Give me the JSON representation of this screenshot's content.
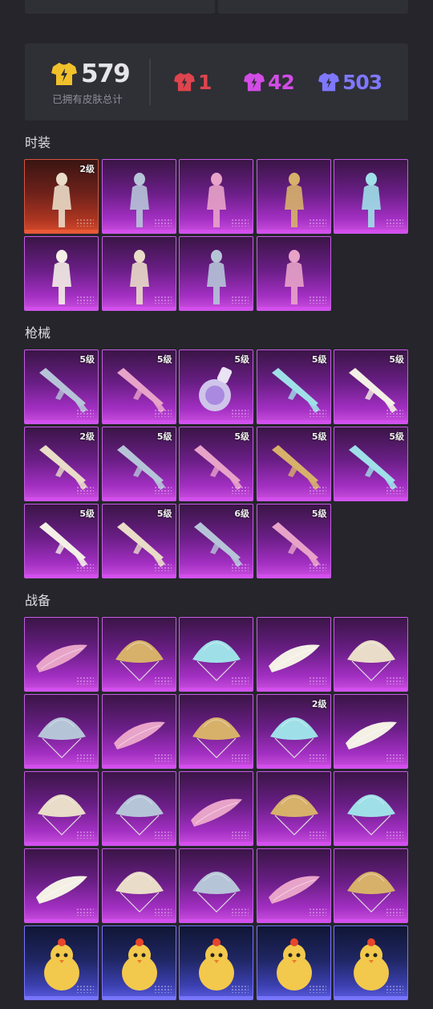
{
  "summary": {
    "total_count": "579",
    "total_label": "已拥有皮肤总计",
    "tiers": [
      {
        "value": "1",
        "color": "#e0444e",
        "icon": "red-shirt-icon"
      },
      {
        "value": "42",
        "color": "#d24ce6",
        "icon": "purple-shirt-icon"
      },
      {
        "value": "503",
        "color": "#7f78ff",
        "icon": "blue-shirt-icon"
      }
    ],
    "total_icon": "gold-shirt-icon",
    "total_color": "#f1c12b"
  },
  "sections": [
    {
      "title": "时装",
      "items": [
        {
          "name": "gold-winged-outfit",
          "rarity": "gold",
          "level": "2级"
        },
        {
          "name": "red-black-armor-outfit",
          "rarity": "purple",
          "level": ""
        },
        {
          "name": "white-gold-robe-outfit",
          "rarity": "purple",
          "level": ""
        },
        {
          "name": "red-hair-girl-outfit",
          "rarity": "purple",
          "level": ""
        },
        {
          "name": "silver-armor-outfit",
          "rarity": "purple",
          "level": ""
        },
        {
          "name": "white-gown-outfit",
          "rarity": "purple",
          "level": ""
        },
        {
          "name": "white-dress-outfit",
          "rarity": "purple",
          "level": ""
        },
        {
          "name": "blue-pink-suit-outfit",
          "rarity": "purple",
          "level": ""
        },
        {
          "name": "purple-helmet-outfit",
          "rarity": "purple",
          "level": ""
        }
      ]
    },
    {
      "title": "枪械",
      "items": [
        {
          "name": "orange-rifle",
          "rarity": "purple",
          "level": "5级"
        },
        {
          "name": "black-sniper-rifle",
          "rarity": "purple",
          "level": "5级"
        },
        {
          "name": "potion-bottle-weapon",
          "rarity": "purple",
          "level": "5级"
        },
        {
          "name": "silver-sniper-rifle",
          "rarity": "purple",
          "level": "5级"
        },
        {
          "name": "red-dragon-rifle",
          "rarity": "purple",
          "level": "5级"
        },
        {
          "name": "golden-rifle",
          "rarity": "purple",
          "level": "2级"
        },
        {
          "name": "steel-rifle",
          "rarity": "purple",
          "level": "5级"
        },
        {
          "name": "blue-silver-rifle",
          "rarity": "purple",
          "level": "5级"
        },
        {
          "name": "ornate-silver-smg",
          "rarity": "purple",
          "level": "5级"
        },
        {
          "name": "pink-black-smg",
          "rarity": "purple",
          "level": "5级"
        },
        {
          "name": "green-rifle",
          "rarity": "purple",
          "level": "5级"
        },
        {
          "name": "blue-smg",
          "rarity": "purple",
          "level": "5级"
        },
        {
          "name": "teal-gold-rifle",
          "rarity": "purple",
          "level": "6级"
        },
        {
          "name": "green-blue-rifle",
          "rarity": "purple",
          "level": "5级"
        }
      ]
    },
    {
      "title": "战备",
      "items": [
        {
          "name": "pink-glider",
          "rarity": "purple",
          "level": ""
        },
        {
          "name": "blue-floral-glider",
          "rarity": "purple",
          "level": ""
        },
        {
          "name": "blue-gold-parachute",
          "rarity": "purple",
          "level": ""
        },
        {
          "name": "lace-cat-parachute",
          "rarity": "purple",
          "level": ""
        },
        {
          "name": "cream-pattern-parachute",
          "rarity": "purple",
          "level": ""
        },
        {
          "name": "white-ornate-parachute",
          "rarity": "purple",
          "level": ""
        },
        {
          "name": "white-dragon-pet",
          "rarity": "purple",
          "level": ""
        },
        {
          "name": "golden-wing-glider",
          "rarity": "purple",
          "level": ""
        },
        {
          "name": "golden-dragon-pet",
          "rarity": "purple",
          "level": "2级"
        },
        {
          "name": "pink-bow-glider",
          "rarity": "purple",
          "level": ""
        },
        {
          "name": "crystal-wing-glider",
          "rarity": "purple",
          "level": ""
        },
        {
          "name": "pink-rose-glider",
          "rarity": "purple",
          "level": ""
        },
        {
          "name": "pink-cat-parachute",
          "rarity": "purple",
          "level": ""
        },
        {
          "name": "black-feather-glider",
          "rarity": "purple",
          "level": ""
        },
        {
          "name": "purple-princess-parachute",
          "rarity": "purple",
          "level": ""
        },
        {
          "name": "purple-crystal-glider",
          "rarity": "purple",
          "level": ""
        },
        {
          "name": "silver-blue-parachute",
          "rarity": "purple",
          "level": ""
        },
        {
          "name": "purple-kite-parachute",
          "rarity": "purple",
          "level": ""
        },
        {
          "name": "jellyfish-parachute",
          "rarity": "purple",
          "level": ""
        },
        {
          "name": "black-gold-parachute",
          "rarity": "purple",
          "level": ""
        },
        {
          "name": "chick-sunglasses-pet",
          "rarity": "blue",
          "level": ""
        },
        {
          "name": "chick-egg-pet",
          "rarity": "blue",
          "level": ""
        },
        {
          "name": "pink-bird-pet",
          "rarity": "blue",
          "level": ""
        },
        {
          "name": "tiger-pet",
          "rarity": "blue",
          "level": ""
        },
        {
          "name": "chick-helmet-pet",
          "rarity": "blue",
          "level": ""
        }
      ]
    }
  ]
}
